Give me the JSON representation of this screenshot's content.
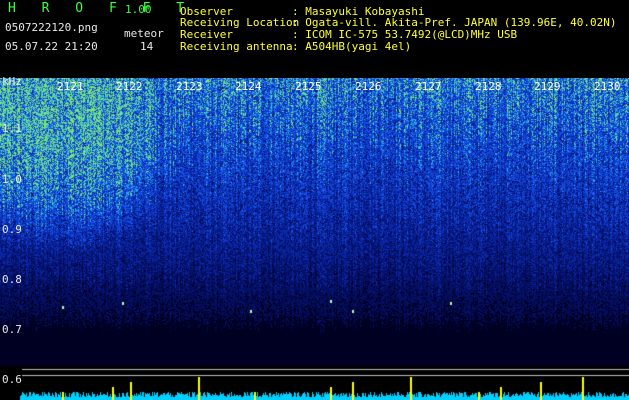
{
  "app": {
    "name": "H R O F F T",
    "version": "1.00"
  },
  "file": {
    "name": "0507222120.png",
    "datetime": "05.07.22 21:20"
  },
  "meteor": {
    "label": "meteor",
    "count": "14"
  },
  "info": [
    {
      "key": "Observer",
      "value": ": Masayuki Kobayashi"
    },
    {
      "key": "Receiving Location",
      "value": ": Ogata-vill. Akita-Pref. JAPAN (139.96E, 40.02N)"
    },
    {
      "key": "Receiver",
      "value": ": ICOM IC-575 53.7492(@LCD)MHz USB"
    },
    {
      "key": "Receiving antenna",
      "value": ": A504HB(yagi 4el)"
    }
  ],
  "axes": {
    "y_unit": "kHz",
    "y_ticks": [
      "1.1",
      "1.0",
      "0.9",
      "0.8",
      "0.7",
      "0.6"
    ],
    "x_ticks": [
      "2121",
      "2122",
      "2123",
      "2124",
      "2125",
      "2126",
      "2127",
      "2128",
      "2129",
      "2130"
    ]
  },
  "colors": {
    "background": "#000000",
    "header_green": "#3dff3d",
    "header_yellow": "#ffff33",
    "spectrum_cyan": "#00d8ff",
    "spectrum_yellow": "#ffff00"
  }
}
